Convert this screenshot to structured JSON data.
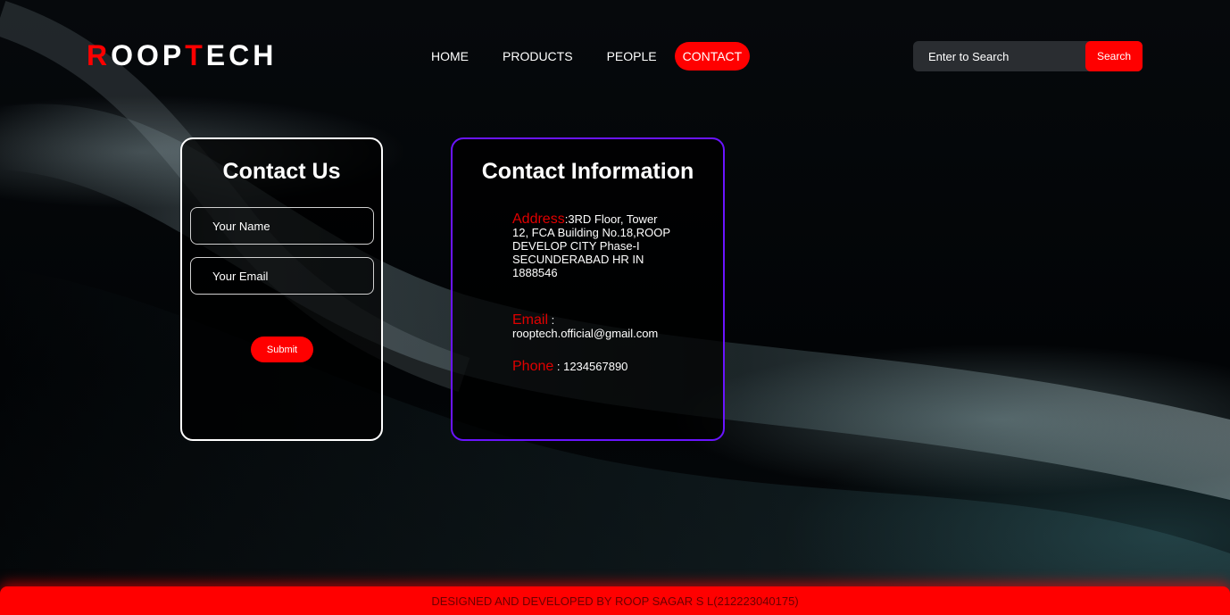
{
  "brand": {
    "letters": [
      {
        "char": "R",
        "color": "#ff0000"
      },
      {
        "char": "OOP",
        "color": "#ffffff"
      },
      {
        "char": "T",
        "color": "#ff0000"
      },
      {
        "char": "ECH",
        "color": "#ffffff"
      }
    ]
  },
  "nav": {
    "items": [
      {
        "label": "HOME",
        "active": false
      },
      {
        "label": "PRODUCTS",
        "active": false
      },
      {
        "label": "PEOPLE",
        "active": false
      },
      {
        "label": "CONTACT",
        "active": true
      }
    ]
  },
  "search": {
    "placeholder": "Enter to Search",
    "button_label": "Search"
  },
  "contact_form": {
    "title": "Contact Us",
    "name_placeholder": "Your Name",
    "email_placeholder": "Your Email",
    "submit_label": "Submit"
  },
  "contact_info": {
    "title": "Contact Information",
    "address_label": "Address",
    "address_value": ":3RD Floor, Tower 12, FCA Building No.18,ROOP DEVELOP CITY Phase-I SECUNDERABAD HR IN 1888546",
    "email_label": "Email",
    "email_sep": " :",
    "email_value": "rooptech.official@gmail.com",
    "phone_label": "Phone",
    "phone_value": " : 1234567890"
  },
  "footer": {
    "text": "DESIGNED AND DEVELOPED BY ROOP SAGAR S L(212223040175)"
  },
  "colors": {
    "accent": "#ff0000",
    "info_border": "#6a14ff",
    "background": "#02060a"
  }
}
